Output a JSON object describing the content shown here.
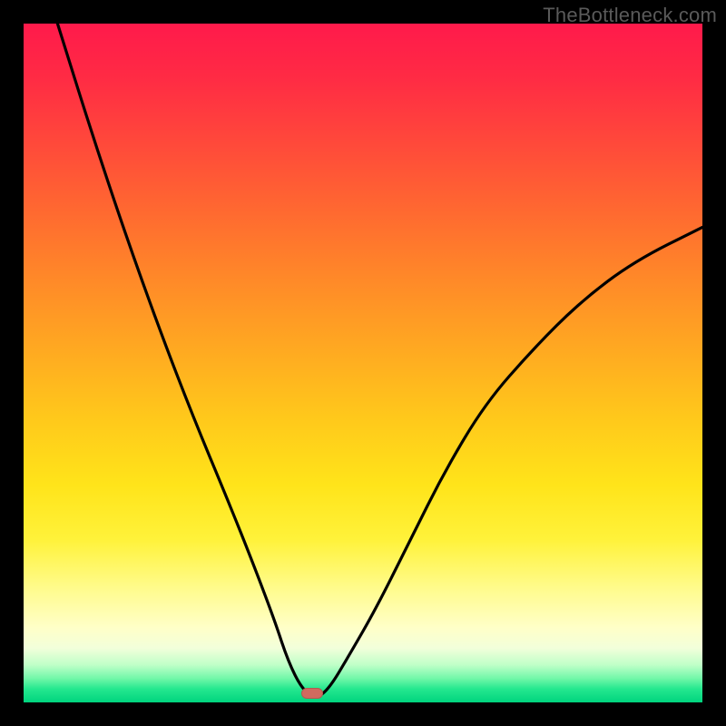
{
  "watermark": "TheBottleneck.com",
  "marker": {
    "x_pct": 42.5,
    "y_pct": 98.6
  },
  "chart_data": {
    "type": "line",
    "title": "",
    "xlabel": "",
    "ylabel": "",
    "xlim": [
      0,
      100
    ],
    "ylim": [
      0,
      100
    ],
    "grid": false,
    "legend": false,
    "series": [
      {
        "name": "bottleneck-curve",
        "x": [
          5,
          10,
          15,
          20,
          25,
          30,
          34,
          37,
          39,
          41,
          43,
          45,
          48,
          52,
          57,
          62,
          68,
          75,
          82,
          90,
          100
        ],
        "y": [
          100,
          84,
          69,
          55,
          42,
          30,
          20,
          12,
          6,
          2,
          0.5,
          2,
          7,
          14,
          24,
          34,
          44,
          52,
          59,
          65,
          70
        ]
      }
    ],
    "annotations": [
      {
        "type": "marker",
        "shape": "pill",
        "x": 42.5,
        "y": 1.4,
        "color": "#d06a5f"
      }
    ]
  }
}
